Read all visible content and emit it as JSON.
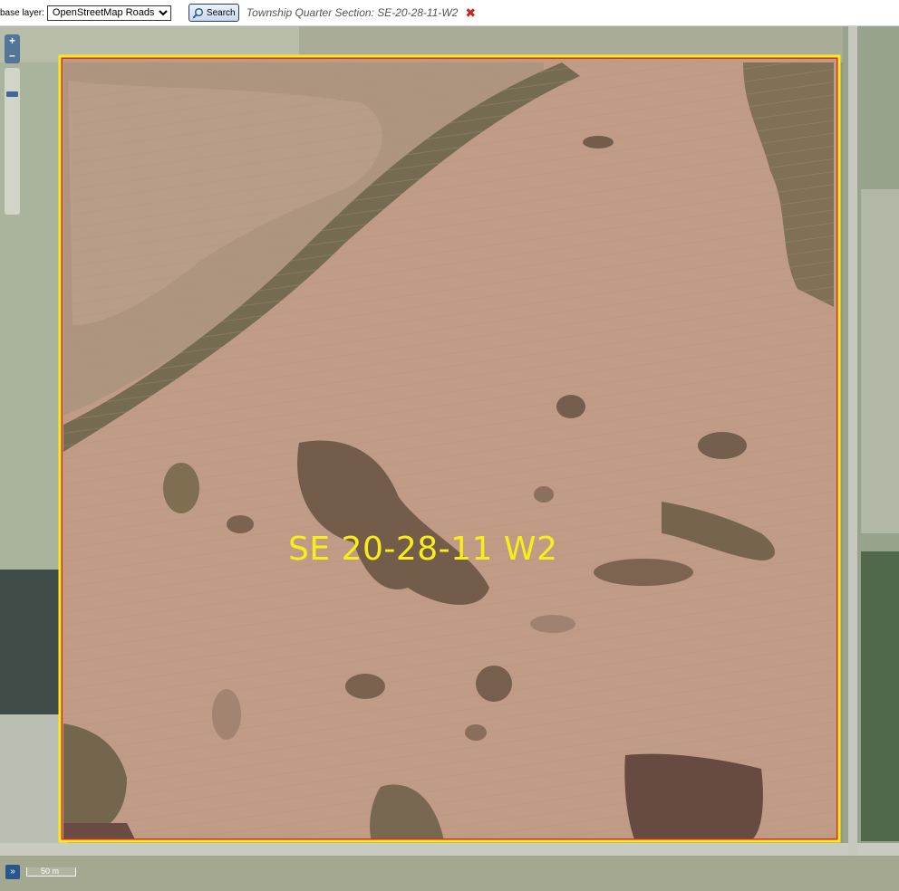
{
  "toolbar": {
    "base_layer_label": "base layer:",
    "base_layer_selected": "OpenStreetMap Roads",
    "search_label": "Search",
    "section_text": "Township Quarter Section: SE-20-28-11-W2",
    "close_glyph": "✖"
  },
  "map": {
    "zoom_in": "+",
    "zoom_out": "–",
    "parcel_label": "SE 20-28-11 W2",
    "expand_glyph": "»",
    "scale_text": "50 m",
    "parcel_border_color": "#ffe81a",
    "parcel_fill_color": "#d99a8c"
  }
}
